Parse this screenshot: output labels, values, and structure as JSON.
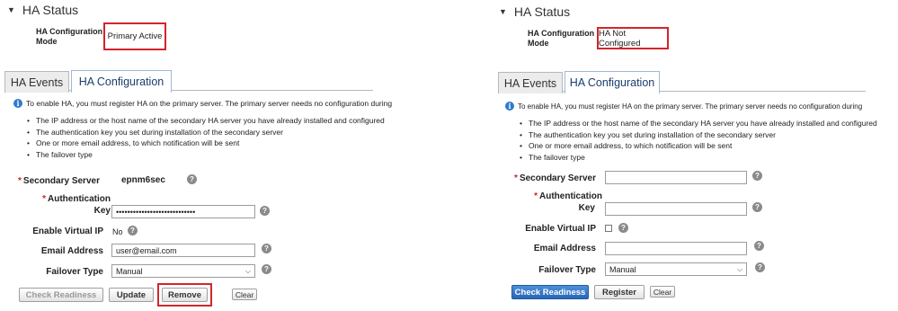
{
  "left": {
    "status_title": "HA Status",
    "mode_label_line1": "HA Configuration",
    "mode_label_line2": "Mode",
    "mode_value": "Primary Active",
    "tabs": [
      {
        "label": "HA Events",
        "active": false
      },
      {
        "label": "HA Configuration",
        "active": true
      }
    ],
    "info_text": "To enable HA, you must register HA on the primary server. The primary server needs no configuration during",
    "bullets": [
      "The IP address or the host name of the secondary HA server you have already installed and configured",
      "The authentication key you set during installation of the secondary server",
      "One or more email address, to which notification will be sent",
      "The failover type"
    ],
    "fields": {
      "secondary_server_label": "Secondary Server",
      "secondary_server_value": "epnm6sec",
      "auth_key_label_line1": "Authentication",
      "auth_key_label_line2": "Key",
      "auth_key_value": "••••••••••••••••••••••••••••",
      "virtual_ip_label": "Enable Virtual IP",
      "virtual_ip_value": "No",
      "email_label": "Email Address",
      "email_value": "user@email.com",
      "failover_label": "Failover Type",
      "failover_value": "Manual"
    },
    "buttons": {
      "check_readiness": "Check Readiness",
      "update": "Update",
      "remove": "Remove",
      "clear": "Clear"
    }
  },
  "right": {
    "status_title": "HA Status",
    "mode_label_line1": "HA Configuration",
    "mode_label_line2": "Mode",
    "mode_value": "HA Not Configured",
    "tabs": [
      {
        "label": "HA Events",
        "active": false
      },
      {
        "label": "HA Configuration",
        "active": true
      }
    ],
    "info_text": "To enable HA, you must register HA on the primary server. The primary server needs no configuration during",
    "bullets": [
      "The IP address or the host name of the secondary HA server you have already installed and configured",
      "The authentication key you set during installation of the secondary server",
      "One or more email address, to which notification will be sent",
      "The failover type"
    ],
    "fields": {
      "secondary_server_label": "Secondary Server",
      "secondary_server_value": "",
      "auth_key_label_line1": "Authentication",
      "auth_key_label_line2": "Key",
      "auth_key_value": "",
      "virtual_ip_label": "Enable Virtual IP",
      "email_label": "Email Address",
      "email_value": "",
      "failover_label": "Failover Type",
      "failover_value": "Manual"
    },
    "buttons": {
      "check_readiness": "Check Readiness",
      "register": "Register",
      "clear": "Clear"
    }
  },
  "colors": {
    "highlight": "#d0262d",
    "required": "#c9252c",
    "primary_button": "#2866b6",
    "info_icon": "#2b7bd0"
  },
  "icons": {
    "collapse": "triangle-down-icon",
    "info": "info-icon",
    "help": "help-icon",
    "dropdown": "chevron-down-icon"
  }
}
